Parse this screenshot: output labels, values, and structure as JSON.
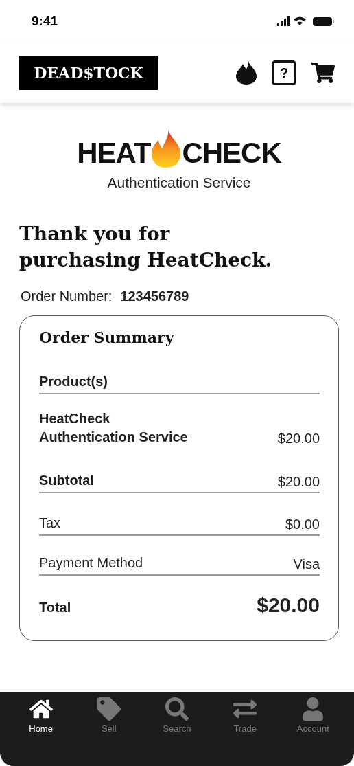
{
  "status_bar": {
    "time": "9:41"
  },
  "header": {
    "logo": "DEAD$TOCK",
    "help": "?"
  },
  "brand": {
    "left": "HEAT",
    "right": "CHECK",
    "subtitle": "Authentication Service"
  },
  "heading": "Thank you for purchasing HeatCheck.",
  "order": {
    "label": "Order Number:",
    "value": "123456789"
  },
  "summary": {
    "title": "Order Summary",
    "rows": [
      {
        "kind": "header",
        "label": "Product(s)"
      },
      {
        "kind": "item",
        "label": "HeatCheck Authentication Service",
        "value": "$20.00"
      },
      {
        "kind": "subtotal",
        "label": "Subtotal",
        "value": "$20.00"
      },
      {
        "kind": "line",
        "label": "Tax",
        "value": "$0.00"
      },
      {
        "kind": "line",
        "label": "Payment Method",
        "value": "Visa"
      },
      {
        "kind": "total",
        "label": "Total",
        "value": "$20.00"
      }
    ]
  },
  "nav": [
    {
      "label": "Home",
      "selected": true
    },
    {
      "label": "Sell",
      "selected": false
    },
    {
      "label": "Search",
      "selected": false
    },
    {
      "label": "Trade",
      "selected": false
    },
    {
      "label": "Account",
      "selected": false
    }
  ]
}
